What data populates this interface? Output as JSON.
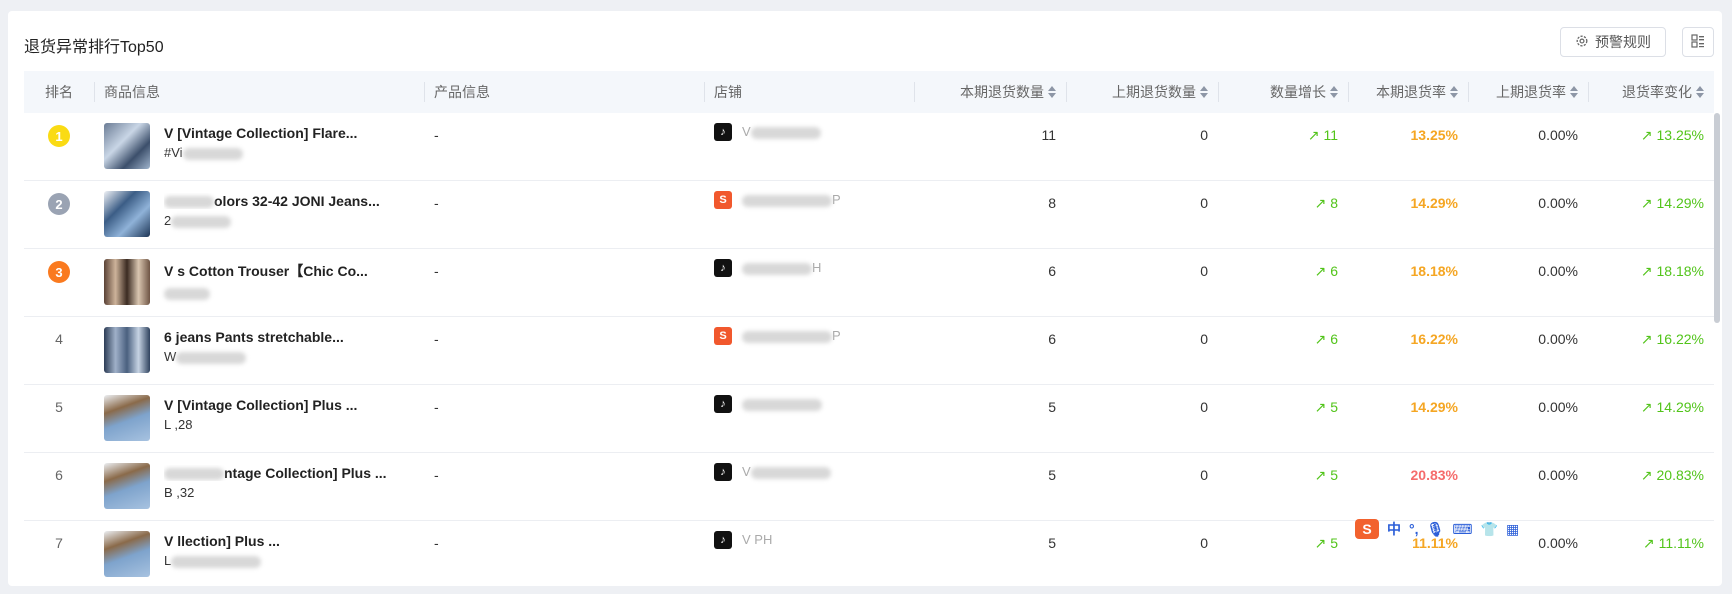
{
  "header": {
    "title": "退货异常排行Top50",
    "rule_button_label": "预警规则"
  },
  "columns": {
    "rank": "排名",
    "goods": "商品信息",
    "product": "产品信息",
    "shop": "店铺",
    "cur_qty": "本期退货数量",
    "prev_qty": "上期退货数量",
    "qty_growth": "数量增长",
    "cur_rate": "本期退货率",
    "prev_rate": "上期退货率",
    "rate_change": "退货率变化"
  },
  "rows": [
    {
      "rank": "1",
      "name": "V  [Vintage Collection] Flare...",
      "sku": "#Vi",
      "product": "-",
      "shop": "V",
      "platform": "tiktok",
      "cur_qty": "11",
      "prev_qty": "0",
      "qty_growth": "11",
      "cur_rate": "13.25%",
      "cur_rate_color": "orange",
      "prev_rate": "0.00%",
      "rate_change": "13.25%"
    },
    {
      "rank": "2",
      "name": "olors 32-42 JONI Jeans...",
      "sku": "2",
      "product": "-",
      "shop": "P",
      "platform": "shopee",
      "cur_qty": "8",
      "prev_qty": "0",
      "qty_growth": "8",
      "cur_rate": "14.29%",
      "cur_rate_color": "orange",
      "prev_rate": "0.00%",
      "rate_change": "14.29%"
    },
    {
      "rank": "3",
      "name": "V  s Cotton Trouser【Chic Co...",
      "sku": "",
      "product": "-",
      "shop": "H",
      "platform": "tiktok",
      "cur_qty": "6",
      "prev_qty": "0",
      "qty_growth": "6",
      "cur_rate": "18.18%",
      "cur_rate_color": "orange",
      "prev_rate": "0.00%",
      "rate_change": "18.18%"
    },
    {
      "rank": "4",
      "name": "6  jeans Pants stretchable...",
      "sku": "W",
      "product": "-",
      "shop": "P",
      "platform": "shopee",
      "cur_qty": "6",
      "prev_qty": "0",
      "qty_growth": "6",
      "cur_rate": "16.22%",
      "cur_rate_color": "orange",
      "prev_rate": "0.00%",
      "rate_change": "16.22%"
    },
    {
      "rank": "5",
      "name": "V  [Vintage Collection] Plus ...",
      "sku": "L  ,28",
      "product": "-",
      "shop": "",
      "platform": "tiktok",
      "cur_qty": "5",
      "prev_qty": "0",
      "qty_growth": "5",
      "cur_rate": "14.29%",
      "cur_rate_color": "orange",
      "prev_rate": "0.00%",
      "rate_change": "14.29%"
    },
    {
      "rank": "6",
      "name": "ntage Collection] Plus ...",
      "sku": "B  ,32",
      "product": "-",
      "shop": "V",
      "platform": "tiktok",
      "cur_qty": "5",
      "prev_qty": "0",
      "qty_growth": "5",
      "cur_rate": "20.83%",
      "cur_rate_color": "red",
      "prev_rate": "0.00%",
      "rate_change": "20.83%"
    },
    {
      "rank": "7",
      "name": "V  llection] Plus ...",
      "sku": "L",
      "product": "-",
      "shop": "V  PH",
      "platform": "tiktok",
      "cur_qty": "5",
      "prev_qty": "0",
      "qty_growth": "5",
      "cur_rate": "11.11%",
      "cur_rate_color": "orange",
      "prev_rate": "0.00%",
      "rate_change": "11.11%"
    }
  ],
  "colors": {
    "badge_gold": "#fadb14",
    "badge_silver": "#9aa3b3",
    "badge_bronze": "#fa7a1f",
    "increase_green": "#52c41a",
    "rate_orange": "#f5a623",
    "rate_red": "#f56c6c"
  },
  "tray": {
    "ime": "中"
  }
}
